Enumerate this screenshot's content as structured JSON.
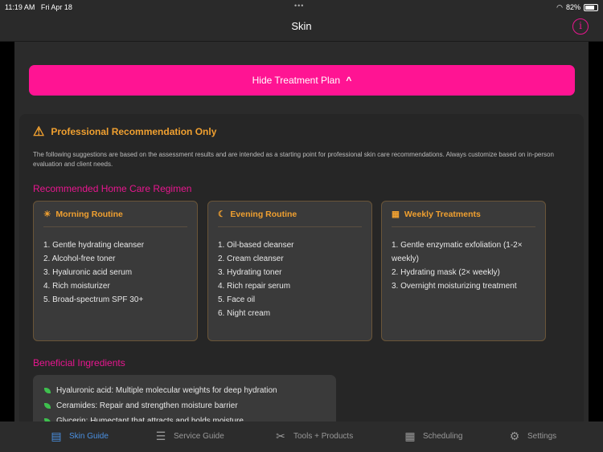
{
  "status": {
    "time": "11:19 AM",
    "date": "Fri Apr 18",
    "battery": "82%",
    "dots": "•••"
  },
  "nav": {
    "title": "Skin",
    "info_icon": "i"
  },
  "toggle": {
    "label": "Hide Treatment Plan",
    "chevron": "⌃"
  },
  "warning": {
    "title": "Professional Recommendation Only",
    "text": "The following suggestions are based on the assessment results and are intended as a starting point for professional skin care recommendations. Always customize based on in-person evaluation and client needs."
  },
  "regimen": {
    "heading": "Recommended Home Care Regimen",
    "cards": [
      {
        "title": "Morning Routine",
        "icon": "☀",
        "items": [
          "1. Gentle hydrating cleanser",
          "2. Alcohol-free toner",
          "3. Hyaluronic acid serum",
          "4. Rich moisturizer",
          "5. Broad-spectrum SPF 30+"
        ]
      },
      {
        "title": "Evening Routine",
        "icon": "☾",
        "items": [
          "1. Oil-based cleanser",
          "2. Cream cleanser",
          "3. Hydrating toner",
          "4. Rich repair serum",
          "5. Face oil",
          "6. Night cream"
        ]
      },
      {
        "title": "Weekly Treatments",
        "icon": "▦",
        "items": [
          "1. Gentle enzymatic exfoliation (1-2× weekly)",
          "2. Hydrating mask (2× weekly)",
          "3. Overnight moisturizing treatment"
        ]
      }
    ]
  },
  "ingredients": {
    "heading": "Beneficial Ingredients",
    "items": [
      "Hyaluronic acid: Multiple molecular weights for deep hydration",
      "Ceramides: Repair and strengthen moisture barrier",
      "Glycerin: Humectant that attracts and holds moisture"
    ]
  },
  "tabs": [
    {
      "label": "Skin Guide",
      "icon": "▤"
    },
    {
      "label": "Service Guide",
      "icon": "☰"
    },
    {
      "label": "Tools + Products",
      "icon": "✂"
    },
    {
      "label": "Scheduling",
      "icon": "▦"
    },
    {
      "label": "Settings",
      "icon": "⚙"
    }
  ],
  "colors": {
    "accent": "#ff1493",
    "warning": "#f0a030",
    "active_tab": "#4a90e2"
  }
}
